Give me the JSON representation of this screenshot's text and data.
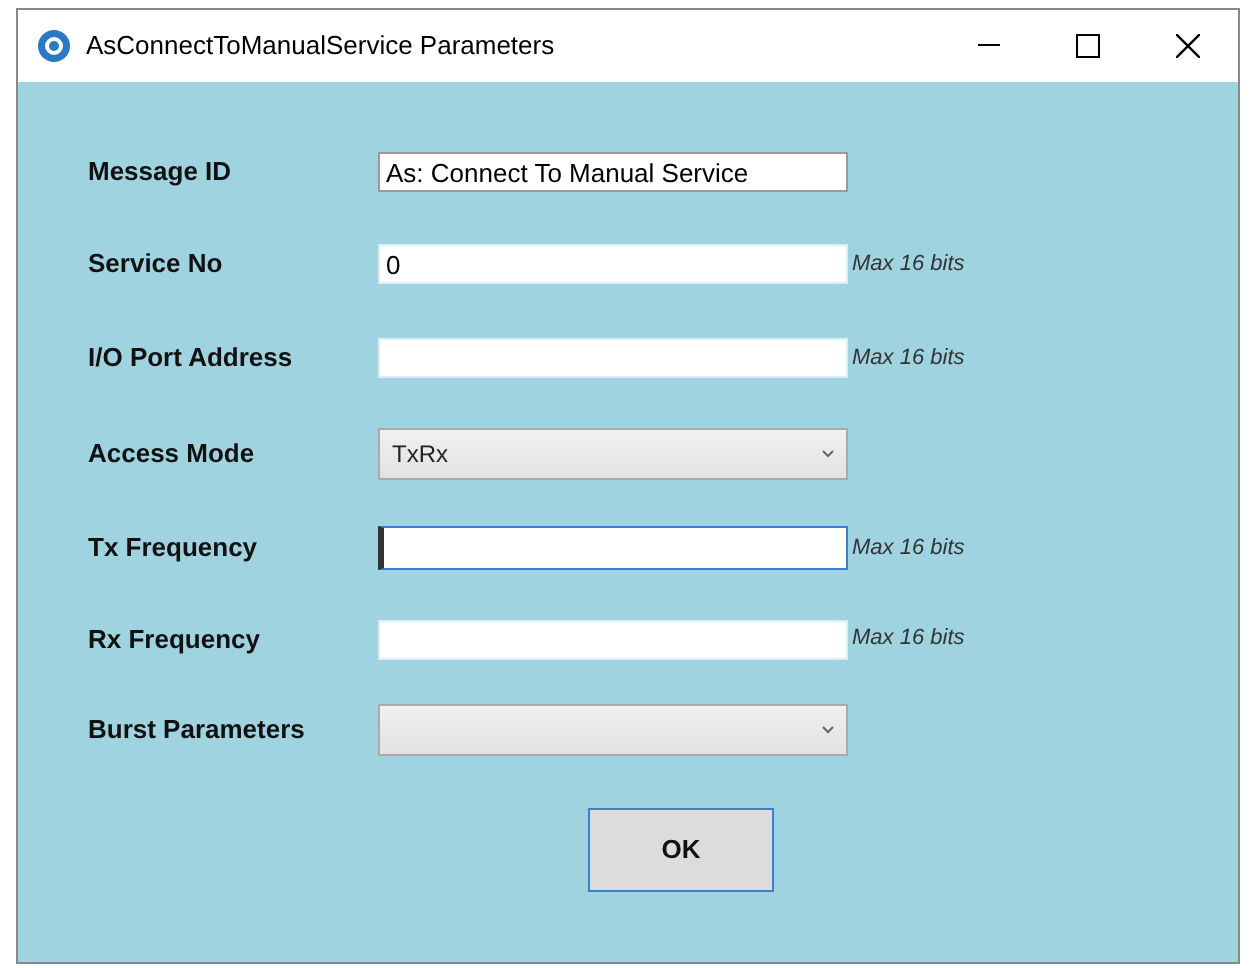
{
  "window": {
    "title": "AsConnectToManualService Parameters"
  },
  "fields": [
    {
      "kind": "readonly",
      "label": "Message ID",
      "value": "As: Connect To Manual Service",
      "focused": false
    },
    {
      "kind": "text",
      "label": "Service No",
      "value": "0",
      "hint": "Max 16 bits",
      "focused": false
    },
    {
      "kind": "text",
      "label": "I/O Port Address",
      "hint": "Max 16 bits",
      "focused": false
    },
    {
      "kind": "combo",
      "label": "Access Mode",
      "value": "TxRx",
      "focused": false
    },
    {
      "kind": "text",
      "label": "Tx Frequency",
      "hint": "Max 16 bits",
      "focused": true
    },
    {
      "kind": "text",
      "label": "Rx Frequency",
      "hint": "Max 16 bits",
      "focused": false
    },
    {
      "kind": "combo",
      "label": "Burst Parameters",
      "focused": false
    }
  ],
  "buttons": [
    {
      "label": "OK"
    }
  ]
}
